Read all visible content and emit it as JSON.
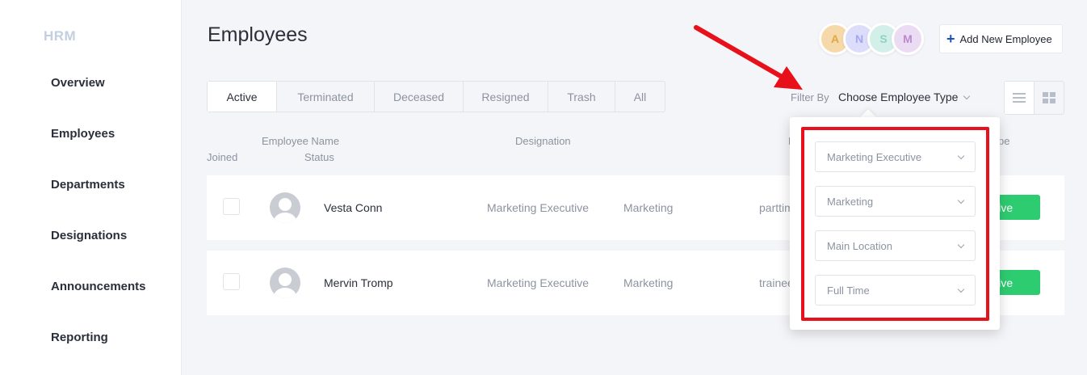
{
  "sidebar": {
    "brand": "HRM",
    "items": [
      {
        "label": "Overview"
      },
      {
        "label": "Employees"
      },
      {
        "label": "Departments"
      },
      {
        "label": "Designations"
      },
      {
        "label": "Announcements"
      },
      {
        "label": "Reporting"
      }
    ]
  },
  "header": {
    "title": "Employees",
    "avatars": [
      {
        "letter": "A",
        "bg": "#f6d9a8",
        "fg": "#e0a649"
      },
      {
        "letter": "N",
        "bg": "#dcdcfb",
        "fg": "#a5a8f0"
      },
      {
        "letter": "S",
        "bg": "#d2efe8",
        "fg": "#8fd2c3"
      },
      {
        "letter": "M",
        "bg": "#ecdcf3",
        "fg": "#b98ad0"
      }
    ],
    "add_button_label": "Add New Employee"
  },
  "tabs": [
    {
      "label": "Active",
      "active": true
    },
    {
      "label": "Terminated",
      "active": false
    },
    {
      "label": "Deceased",
      "active": false
    },
    {
      "label": "Resigned",
      "active": false
    },
    {
      "label": "Trash",
      "active": false
    },
    {
      "label": "All",
      "active": false
    }
  ],
  "filter": {
    "label": "Filter By",
    "selected": "Choose Employee Type"
  },
  "table": {
    "headers": {
      "employee_name": "Employee Name",
      "joined": "Joined",
      "status": "Status",
      "designation": "Designation",
      "partial_d": "D",
      "partial_pe": "pe"
    },
    "rows": [
      {
        "name": "Vesta Conn",
        "designation": "Marketing Executive",
        "department": "Marketing",
        "type": "parttim",
        "status": "Active"
      },
      {
        "name": "Mervin Tromp",
        "designation": "Marketing Executive",
        "department": "Marketing",
        "type": "trainee",
        "status": "Active"
      }
    ]
  },
  "filter_dropdown": {
    "selects": [
      {
        "value": "Marketing Executive"
      },
      {
        "value": "Marketing"
      },
      {
        "value": "Main Location"
      },
      {
        "value": "Full Time"
      }
    ]
  },
  "annotation_color": "#e8101a"
}
